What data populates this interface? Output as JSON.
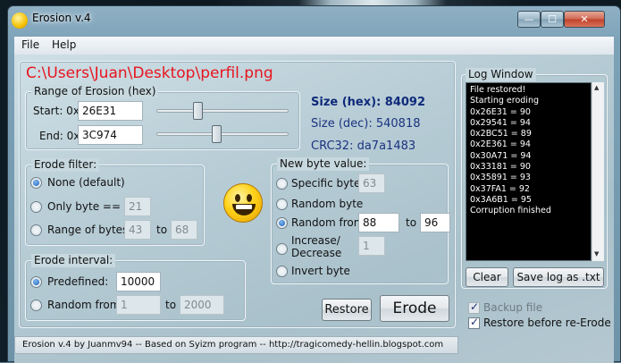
{
  "window": {
    "title": "Erosion v.4",
    "icon": "smiley-icon"
  },
  "caption_buttons": {
    "minimize": "—",
    "maximize": "☐",
    "close": "✕"
  },
  "menu": [
    "File",
    "Help"
  ],
  "file_path": "C:\\Users\\Juan\\Desktop\\perfil.png",
  "range": {
    "label": "Range of Erosion (hex)",
    "start_label": "Start: 0x",
    "start_value": "26E31",
    "end_label": "End:  0x",
    "end_value": "3C974",
    "start_slider_fraction": 0.28,
    "end_slider_fraction": 0.42
  },
  "file_info": {
    "size_hex": "Size (hex): 84092",
    "size_dec": "Size (dec): 540818",
    "crc32": "CRC32: da7a1483"
  },
  "erode_filter": {
    "label": "Erode filter:",
    "none": "None (default)",
    "only_byte": "Only byte ==",
    "only_byte_value": "21",
    "range_label": "Range of bytes",
    "range_from": "43",
    "range_to_label": "to",
    "range_to": "68",
    "selected": "none"
  },
  "erode_interval": {
    "label": "Erode interval:",
    "predefined": "Predefined:",
    "predefined_value": "10000",
    "random_from": "Random from",
    "random_from_value": "1",
    "to_label": "to",
    "random_to_value": "2000",
    "selected": "predefined"
  },
  "new_byte": {
    "label": "New byte value:",
    "specific": "Specific byte:",
    "specific_value": "63",
    "random": "Random byte",
    "random_from": "Random from",
    "random_from_value": "88",
    "to_label": "to",
    "random_to_value": "96",
    "inc_dec_1": "Increase/",
    "inc_dec_2": "Decrease",
    "inc_dec_value": "1",
    "invert": "Invert byte",
    "selected": "random_from"
  },
  "buttons": {
    "restore": "Restore",
    "erode": "Erode",
    "clear": "Clear",
    "save_log": "Save log as .txt"
  },
  "log": {
    "label": "Log Window",
    "lines": [
      "File restored!",
      "Starting eroding",
      "0x26E31 = 90",
      "0x29541 = 94",
      "0x2BC51 = 89",
      "0x2E361 = 94",
      "0x30A71 = 94",
      "0x33181 = 90",
      "0x35891 = 93",
      "0x37FA1 = 92",
      "0x3A6B1 = 95",
      "Corruption finished"
    ]
  },
  "options": {
    "backup_file": "Backup file",
    "backup_checked": true,
    "backup_enabled": false,
    "restore_before": "Restore before re-Erode",
    "restore_checked": true
  },
  "status_bar": "Erosion v.4 by Juanmv94  --  Based on Syizm program  --  http://tragicomedy-hellin.blogspot.com"
}
